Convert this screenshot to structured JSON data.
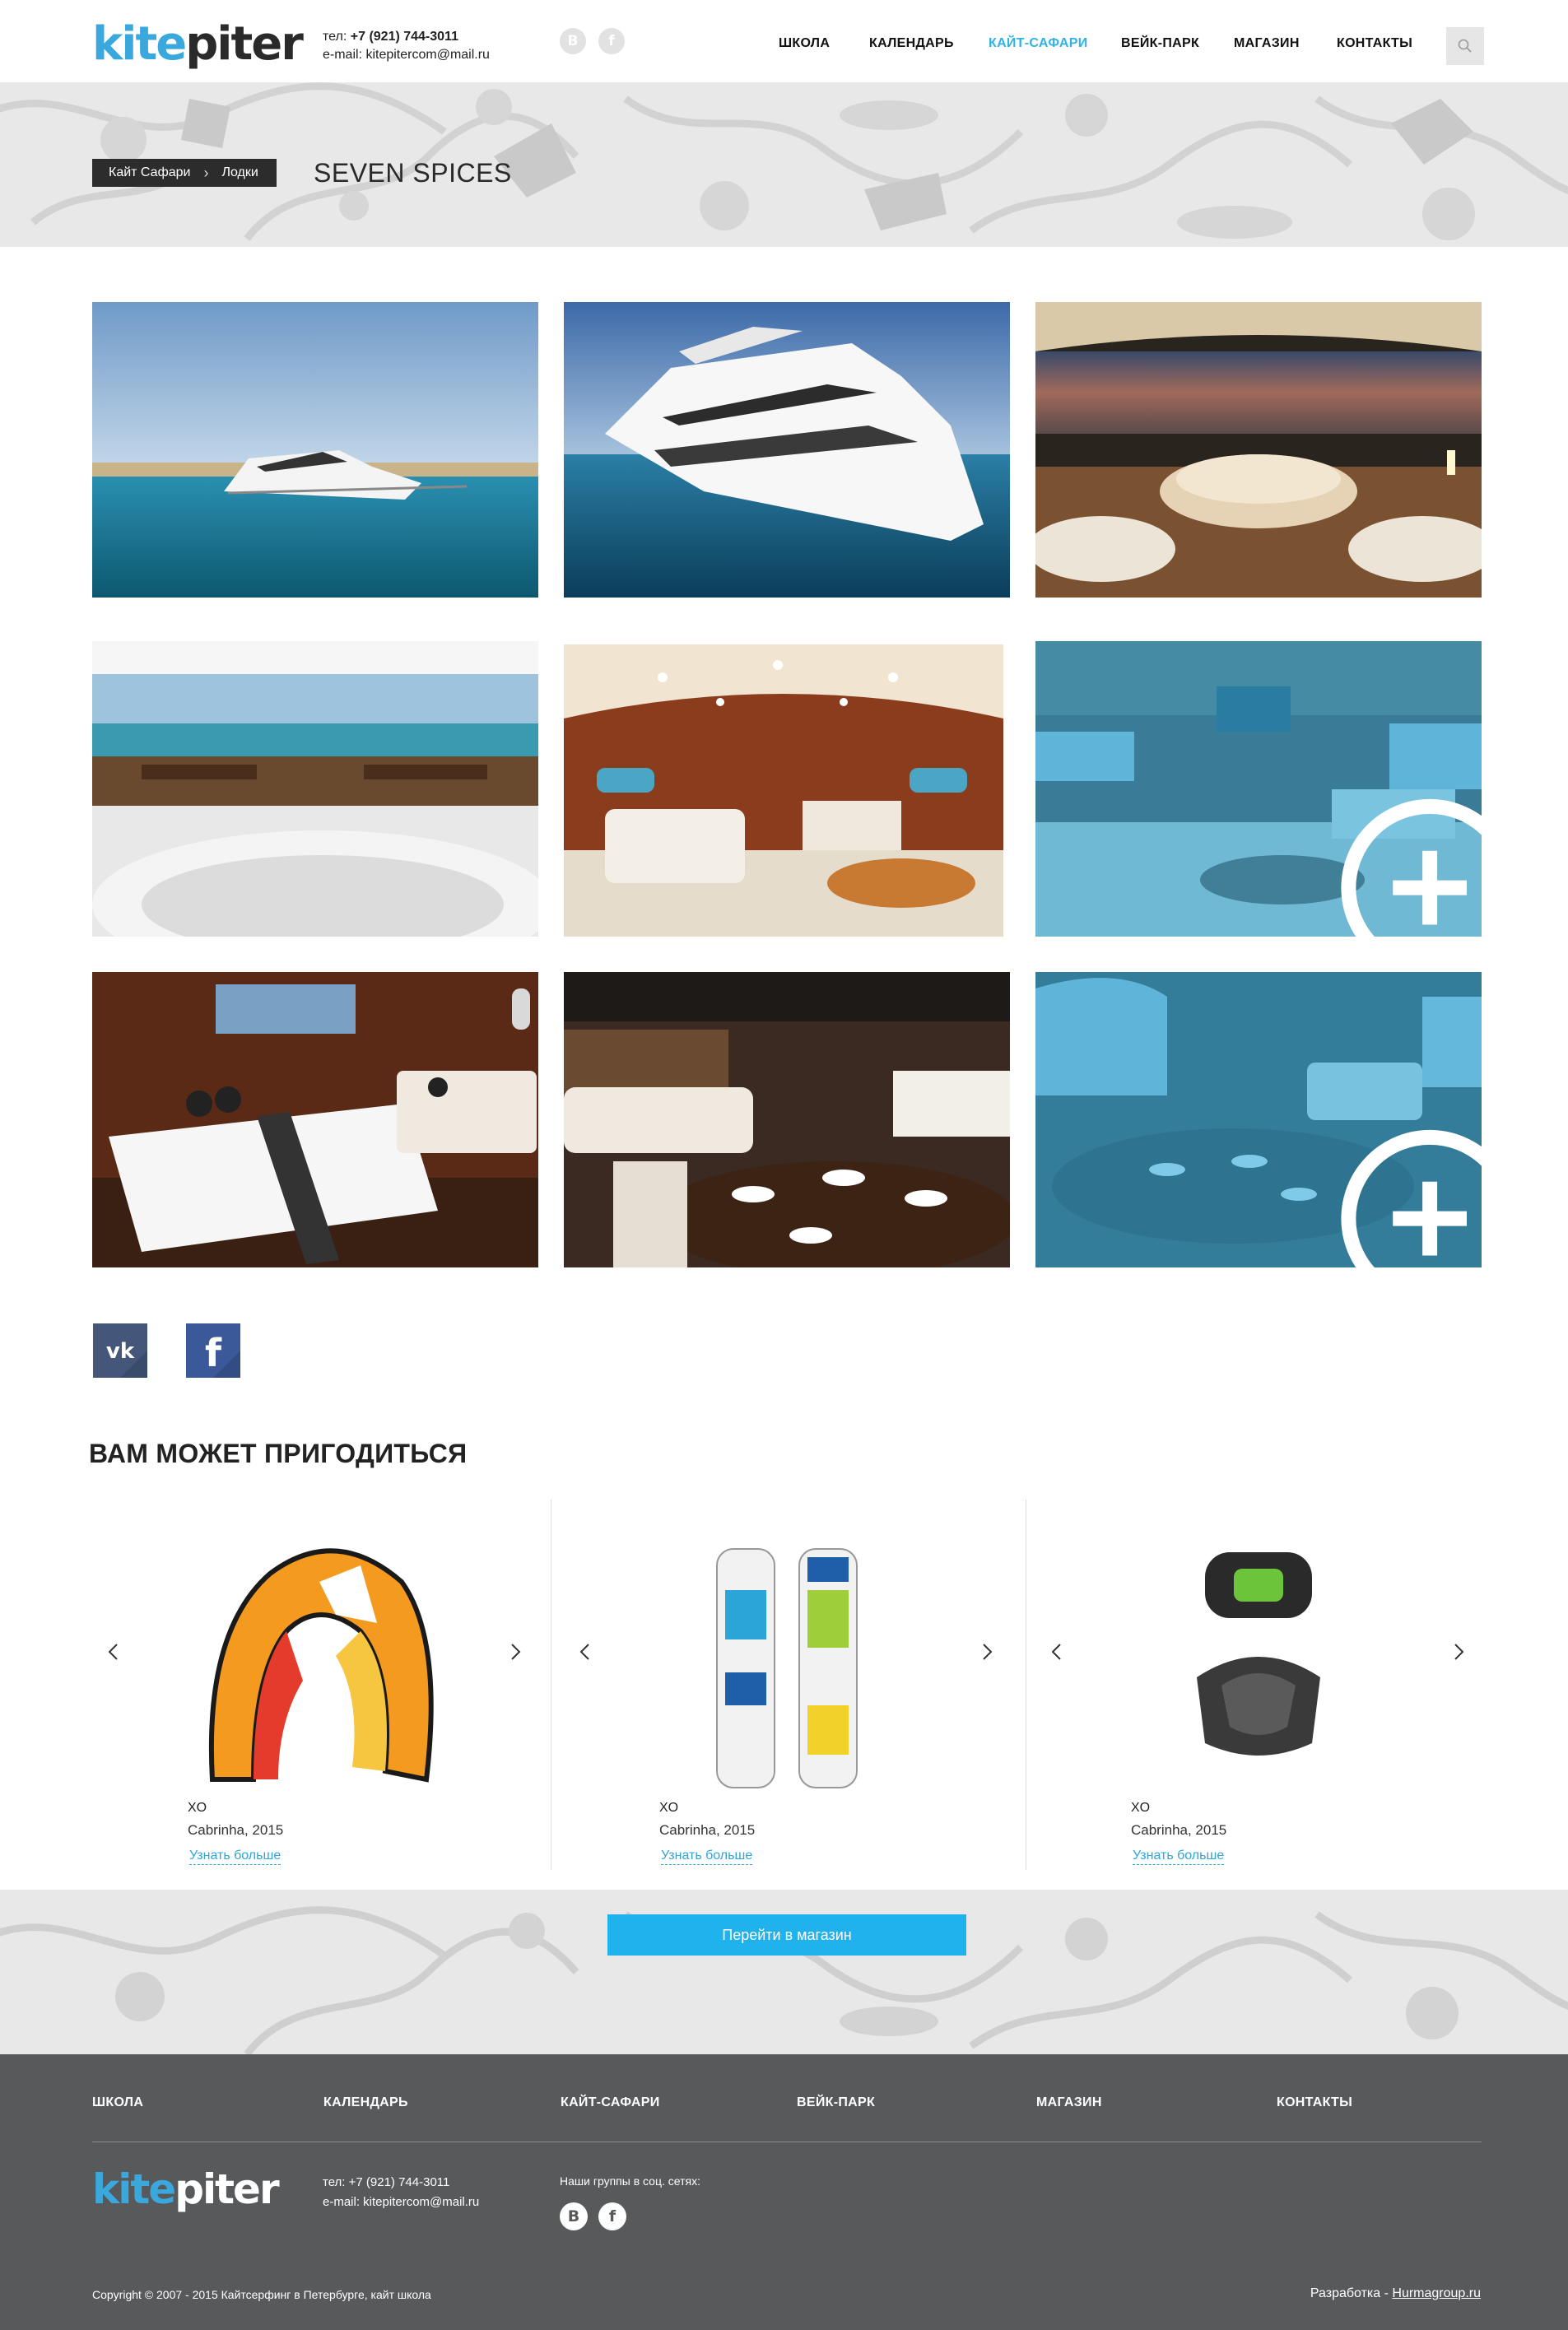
{
  "header": {
    "logo_a": "kite",
    "logo_b": "piter",
    "phone_label": "тел:",
    "phone": "+7 (921) 744-3011",
    "email": "e-mail: kitepitercom@mail.ru",
    "social": [
      "В",
      "f"
    ]
  },
  "nav": [
    "ШКОЛА",
    "КАЛЕНДАРЬ",
    "КАЙТ-САФАРИ",
    "ВЕЙК-ПАРК",
    "МАГАЗИН",
    "КОНТАКТЫ"
  ],
  "nav_active": "КАЙТ-САФАРИ",
  "colors": {
    "accent": "#31b2e5",
    "dark": "#2c2c2c",
    "footer": "#58595b",
    "button": "#1fb2ec"
  },
  "breadcrumb": [
    "Кайт Сафари",
    "Лодки"
  ],
  "page_title": "SEVEN SPICES",
  "gallery": [
    {
      "name": "yacht-exterior-far",
      "hovered": false
    },
    {
      "name": "yacht-exterior-near",
      "hovered": false
    },
    {
      "name": "jacuzzi-deck-night",
      "hovered": false
    },
    {
      "name": "deck-jacuzzi-seating",
      "hovered": false
    },
    {
      "name": "salon-wood",
      "hovered": false
    },
    {
      "name": "salon-tv",
      "hovered": true
    },
    {
      "name": "bedroom",
      "hovered": false
    },
    {
      "name": "dining-salon",
      "hovered": false
    },
    {
      "name": "dining-window",
      "hovered": true
    }
  ],
  "share": [
    "vk-icon",
    "facebook-icon"
  ],
  "section_title": "ВАМ МОЖЕТ ПРИГОДИТЬСЯ",
  "products": [
    {
      "image": "kite-icon",
      "name": "XO",
      "brand": "Cabrinha, 2015",
      "link": "Узнать больше"
    },
    {
      "image": "kiteboard-icon",
      "name": "XO",
      "brand": "Cabrinha, 2015",
      "link": "Узнать больше"
    },
    {
      "image": "harness-icon",
      "name": "XO",
      "brand": "Cabrinha, 2015",
      "link": "Узнать больше"
    }
  ],
  "shop_button": "Перейти в магазин",
  "footer": {
    "nav": [
      "ШКОЛА",
      "КАЛЕНДАРЬ",
      "КАЙТ-САФАРИ",
      "ВЕЙК-ПАРК",
      "МАГАЗИН",
      "КОНТАКТЫ"
    ],
    "phone": "тел: +7 (921) 744-3011",
    "email": "e-mail: kitepitercom@mail.ru",
    "groups_label": "Наши группы в соц. сетях:",
    "social": [
      "В",
      "f"
    ],
    "copyright": "Copyright © 2007 - 2015 Кайтсерфинг в Петербурге, кайт школа",
    "dev_label": "Разработка - ",
    "dev_link": "Hurmagroup.ru"
  }
}
